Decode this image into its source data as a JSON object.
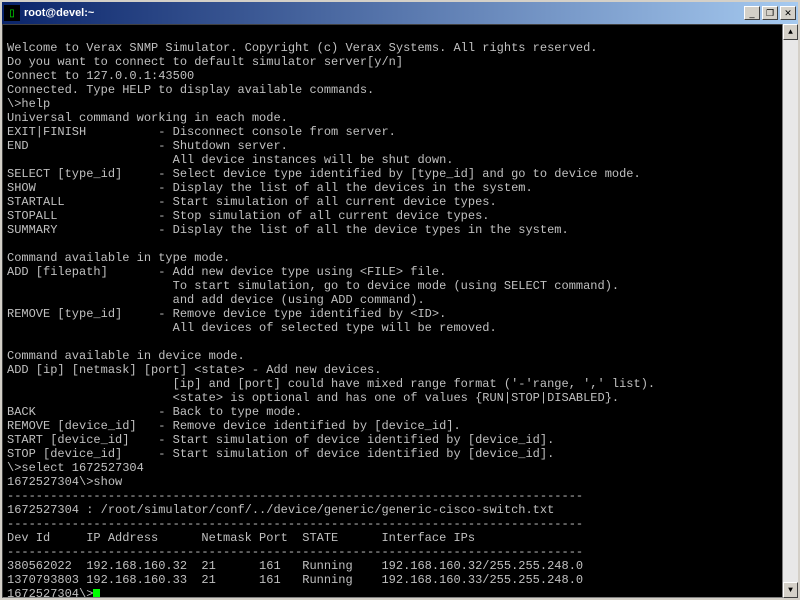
{
  "titlebar": {
    "icon_glyph": "▯",
    "title": "root@devel:~",
    "min_label": "_",
    "max_label": "❐",
    "close_label": "✕"
  },
  "scroll": {
    "up": "▲",
    "down": "▼"
  },
  "session": {
    "welcome": "Welcome to Verax SNMP Simulator. Copyright (c) Verax Systems. All rights reserved.",
    "prompt1": "Do you want to connect to default simulator server[y/n]",
    "connect": "Connect to 127.0.0.1:43500",
    "connected": "Connected. Type HELP to display available commands.",
    "cmd_help": "\\>help",
    "universal_hdr": "Universal command working in each mode.",
    "exit": "EXIT|FINISH          - Disconnect console from server.",
    "end1": "END                  - Shutdown server.",
    "end2": "                       All device instances will be shut down.",
    "select": "SELECT [type_id]     - Select device type identified by [type_id] and go to device mode.",
    "show": "SHOW                 - Display the list of all the devices in the system.",
    "startall": "STARTALL             - Start simulation of all current device types.",
    "stopall": "STOPALL              - Stop simulation of all current device types.",
    "summary": "SUMMARY              - Display the list of all the device types in the system.",
    "typemode_hdr": "Command available in type mode.",
    "add1": "ADD [filepath]       - Add new device type using <FILE> file.",
    "add2": "                       To start simulation, go to device mode (using SELECT command).",
    "add3": "                       and add device (using ADD command).",
    "remove1": "REMOVE [type_id]     - Remove device type identified by <ID>.",
    "remove2": "                       All devices of selected type will be removed.",
    "devmode_hdr": "Command available in device mode.",
    "devadd1": "ADD [ip] [netmask] [port] <state> - Add new devices.",
    "devadd2": "                       [ip] and [port] could have mixed range format ('-'range, ',' list).",
    "devadd3": "                       <state> is optional and has one of values {RUN|STOP|DISABLED}.",
    "back": "BACK                 - Back to type mode.",
    "devremove": "REMOVE [device_id]   - Remove device identified by [device_id].",
    "devstart": "START [device_id]    - Start simulation of device identified by [device_id].",
    "devstop": "STOP [device_id]     - Start simulation of device identified by [device_id].",
    "cmd_select": "\\>select 1672527304",
    "cmd_show": "1672527304\\>show",
    "hr": "--------------------------------------------------------------------------------",
    "path": "1672527304 : /root/simulator/conf/../device/generic/generic-cisco-switch.txt",
    "table_hdr": "Dev Id     IP Address      Netmask Port  STATE      Interface IPs",
    "row1": "380562022  192.168.160.32  21      161   Running    192.168.160.32/255.255.248.0",
    "row2": "1370793803 192.168.160.33  21      161   Running    192.168.160.33/255.255.248.0",
    "prompt_final": "1672527304\\>"
  }
}
